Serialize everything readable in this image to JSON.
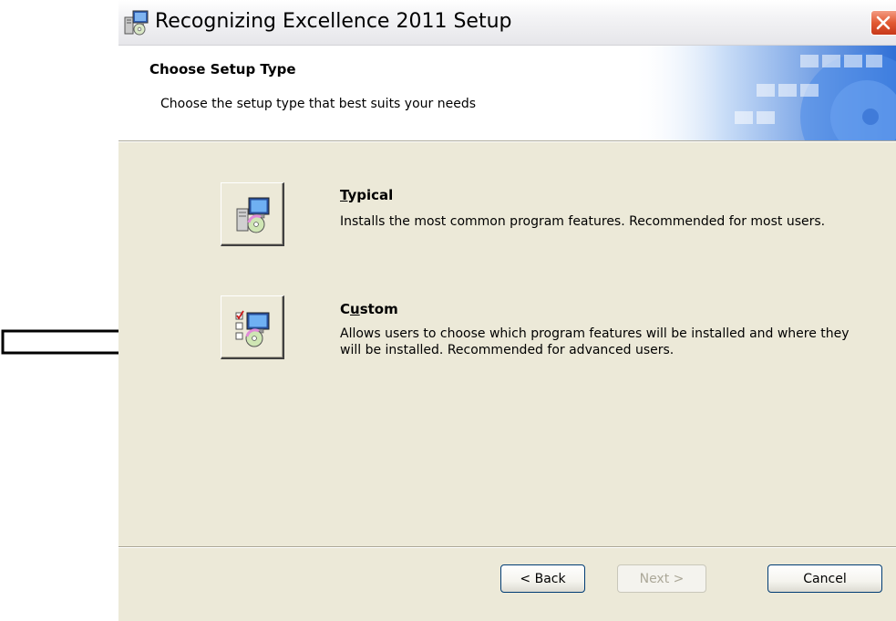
{
  "window": {
    "title": "Recognizing Excellence 2011 Setup",
    "icon": "setup-installer-icon"
  },
  "header": {
    "title": "Choose Setup Type",
    "subtitle": "Choose the setup type that best suits your needs"
  },
  "options": {
    "typical": {
      "title_prefix": "",
      "title_accel": "T",
      "title_rest": "ypical",
      "description": "Installs the most common program features. Recommended for most users.",
      "icon": "typical-install-icon"
    },
    "custom": {
      "title_prefix": "C",
      "title_accel": "u",
      "title_rest": "stom",
      "description": "Allows users to choose which program features will be installed and where they will be installed. Recommended for advanced users.",
      "icon": "custom-install-icon"
    }
  },
  "buttons": {
    "back": "< Back",
    "next": "Next >",
    "cancel": "Cancel",
    "next_enabled": false
  },
  "annotation": {
    "icon": "right-arrow-icon",
    "points_to": "custom"
  },
  "colors": {
    "dialog_bg": "#ece9d8",
    "close_button": "#e25a32",
    "banner_accent": "#3d7ee0",
    "disabled_text": "#aca899"
  }
}
